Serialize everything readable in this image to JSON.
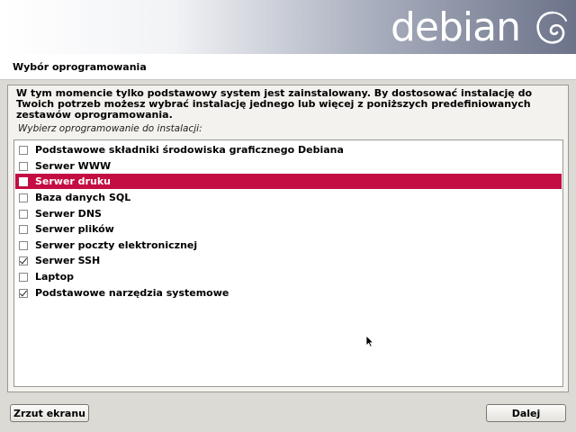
{
  "header": {
    "logo_text": "debian"
  },
  "page": {
    "title": "Wybór oprogramowania",
    "description": "W tym momencie tylko podstawowy system jest zainstalowany. By dostosować instalację do Twoich potrzeb możesz wybrać instalację jednego lub więcej z poniższych predefiniowanych zestawów oprogramowania.",
    "prompt": "Wybierz oprogramowanie do instalacji:"
  },
  "tasks": [
    {
      "label": "Podstawowe składniki środowiska graficznego Debiana",
      "checked": false,
      "selected": false
    },
    {
      "label": "Serwer WWW",
      "checked": false,
      "selected": false
    },
    {
      "label": "Serwer druku",
      "checked": false,
      "selected": true
    },
    {
      "label": "Baza danych SQL",
      "checked": false,
      "selected": false
    },
    {
      "label": "Serwer DNS",
      "checked": false,
      "selected": false
    },
    {
      "label": "Serwer plików",
      "checked": false,
      "selected": false
    },
    {
      "label": "Serwer poczty elektronicznej",
      "checked": false,
      "selected": false
    },
    {
      "label": "Serwer SSH",
      "checked": true,
      "selected": false
    },
    {
      "label": "Laptop",
      "checked": false,
      "selected": false
    },
    {
      "label": "Podstawowe narzędzia systemowe",
      "checked": true,
      "selected": false
    }
  ],
  "buttons": {
    "screenshot": "Zrzut ekranu",
    "continue": "Dalej"
  },
  "colors": {
    "selection": "#c40d42",
    "background": "#dcdad5"
  }
}
